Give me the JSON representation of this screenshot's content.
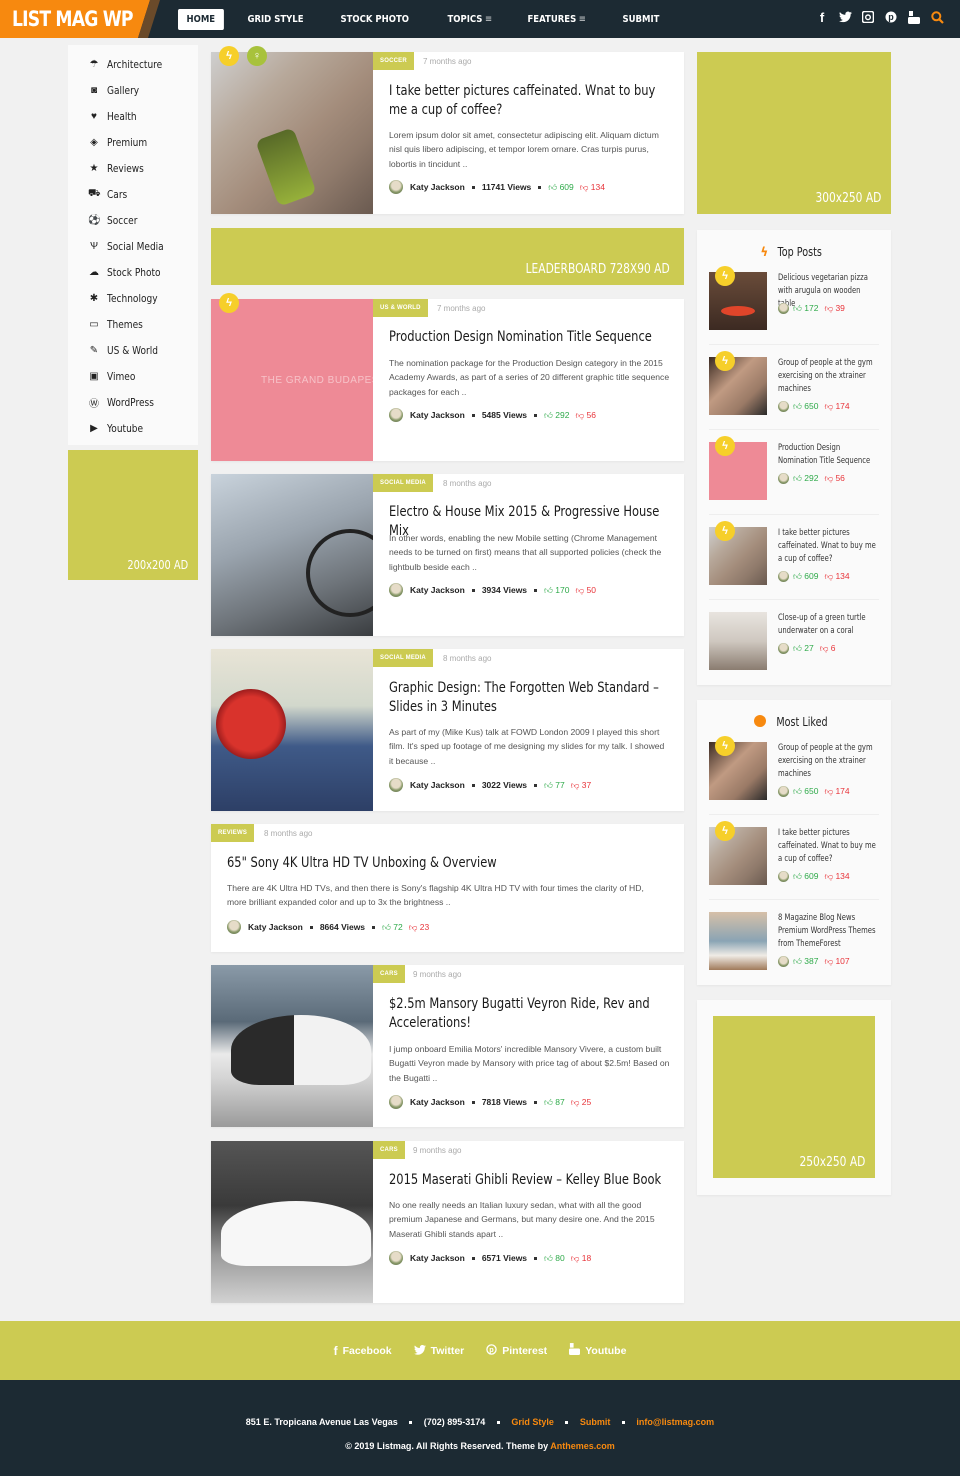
{
  "header": {
    "logo": "LIST MAG WP",
    "nav": [
      {
        "label": "HOME",
        "active": true
      },
      {
        "label": "GRID STYLE"
      },
      {
        "label": "STOCK PHOTO"
      },
      {
        "label": "TOPICS",
        "menu": "≡"
      },
      {
        "label": "FEATURES",
        "menu": "≡"
      },
      {
        "label": "SUBMIT"
      }
    ],
    "social_icons": [
      "facebook-icon",
      "twitter-icon",
      "instagram-icon",
      "pinterest-icon",
      "youtube-icon",
      "search-icon"
    ],
    "accent_color": "#f7890f",
    "bg_color": "#1c2a33"
  },
  "left_sidebar": {
    "categories": [
      {
        "label": "Architecture",
        "icon": "umbrella-icon"
      },
      {
        "label": "Gallery",
        "icon": "camera-icon"
      },
      {
        "label": "Health",
        "icon": "heartbeat-icon"
      },
      {
        "label": "Premium",
        "icon": "cube-icon"
      },
      {
        "label": "Reviews",
        "icon": "star-icon"
      },
      {
        "label": "Cars",
        "icon": "car-icon"
      },
      {
        "label": "Soccer",
        "icon": "soccer-ball-icon"
      },
      {
        "label": "Social Media",
        "icon": "rebel-icon"
      },
      {
        "label": "Stock Photo",
        "icon": "cloud-upload-icon"
      },
      {
        "label": "Technology",
        "icon": "bug-icon"
      },
      {
        "label": "Themes",
        "icon": "laptop-icon"
      },
      {
        "label": "US & World",
        "icon": "pen-icon"
      },
      {
        "label": "Vimeo",
        "icon": "vimeo-icon"
      },
      {
        "label": "WordPress",
        "icon": "wordpress-icon"
      },
      {
        "label": "Youtube",
        "icon": "youtube-play-icon"
      }
    ],
    "ad_label": "200x200 AD"
  },
  "leaderboard_ad": "LEADERBOARD 728X90 AD",
  "posts": [
    {
      "category": "SOCCER",
      "time": "7 months ago",
      "title": "I take better pictures caffeinated. Wnat to buy me a cup of coffee?",
      "excerpt": "Lorem ipsum dolor sit amet, consectetur adipiscing elit. Aliquam dictum nisl quis libero adipiscing, et tempor lorem ornare. Cras turpis purus, lobortis in tincidunt ..",
      "author": "Katy Jackson",
      "views": "11741 Views",
      "likes": "609",
      "dislikes": "134"
    },
    {
      "category": "US & WORLD",
      "time": "7 months ago",
      "title": "Production Design Nomination Title Sequence",
      "excerpt": "The nomination package for the Production Design category in the 2015 Academy Awards, as part of a series of 20 different graphic title sequence packages for each ..",
      "author": "Katy Jackson",
      "views": "5485 Views",
      "likes": "292",
      "dislikes": "56"
    },
    {
      "category": "SOCIAL MEDIA",
      "time": "8 months ago",
      "title": "Electro & House Mix 2015 & Progressive House Mix",
      "excerpt": "In other words, enabling the new Mobile setting (Chrome Management needs to be turned on first) means that all supported policies (check the lightbulb beside each ..",
      "author": "Katy Jackson",
      "views": "3934 Views",
      "likes": "170",
      "dislikes": "50"
    },
    {
      "category": "SOCIAL MEDIA",
      "time": "8 months ago",
      "title": "Graphic Design: The Forgotten Web Standard – Slides in 3 Minutes",
      "excerpt": "As part of my (Mike Kus) talk at FOWD London 2009 I played this short film. It's sped up footage of me designing my slides for my talk. I showed it because ..",
      "author": "Katy Jackson",
      "views": "3022 Views",
      "likes": "77",
      "dislikes": "37"
    },
    {
      "category": "REVIEWS",
      "time": "8 months ago",
      "title": "65\" Sony 4K Ultra HD TV Unboxing & Overview",
      "excerpt": "There are 4K Ultra HD TVs, and then there is Sony's flagship 4K Ultra HD TV with four times the clarity of HD, more brilliant expanded color and up to 3x the brightness ..",
      "author": "Katy Jackson",
      "views": "8664 Views",
      "likes": "72",
      "dislikes": "23"
    },
    {
      "category": "CARS",
      "time": "9 months ago",
      "title": "$2.5m Mansory Bugatti Veyron Ride, Rev and Accelerations!",
      "excerpt": "I jump onboard Emilia Motors' incredible Mansory Vivere, a custom built Bugatti Veyron made by Mansory with price tag of about $2.5m! Based on the Bugatti ..",
      "author": "Katy Jackson",
      "views": "7818 Views",
      "likes": "87",
      "dislikes": "25"
    },
    {
      "category": "CARS",
      "time": "9 months ago",
      "title": "2015 Maserati Ghibli Review – Kelley Blue Book",
      "excerpt": "No one really needs an Italian luxury sedan, what with all the good premium Japanese and Germans, but many desire one. And the 2015 Maserati Ghibli stands apart ..",
      "author": "Katy Jackson",
      "views": "6571 Views",
      "likes": "80",
      "dislikes": "18"
    }
  ],
  "right_sidebar": {
    "ad_top": "300x250 AD",
    "top_posts": {
      "title": "Top Posts",
      "items": [
        {
          "title": "Delicious vegetarian pizza with arugula on wooden table",
          "likes": "172",
          "dislikes": "39"
        },
        {
          "title": "Group of people at the gym exercising on the xtrainer machines",
          "likes": "650",
          "dislikes": "174"
        },
        {
          "title": "Production Design Nomination Title Sequence",
          "likes": "292",
          "dislikes": "56"
        },
        {
          "title": "I take better pictures caffeinated. Wnat to buy me a cup of coffee?",
          "likes": "609",
          "dislikes": "134"
        },
        {
          "title": "Close-up of a green turtle underwater on a coral",
          "likes": "27",
          "dislikes": "6"
        }
      ]
    },
    "most_liked": {
      "title": "Most Liked",
      "items": [
        {
          "title": "Group of people at the gym exercising on the xtrainer machines",
          "likes": "650",
          "dislikes": "174"
        },
        {
          "title": "I take better pictures caffeinated. Wnat to buy me a cup of coffee?",
          "likes": "609",
          "dislikes": "134"
        },
        {
          "title": "8 Magazine Blog News Premium WordPress Themes from ThemeForest",
          "likes": "387",
          "dislikes": "107"
        }
      ]
    },
    "ad_bottom": "250x250 AD",
    "ad_color": "#cccb52"
  },
  "footer": {
    "social": [
      {
        "label": "Facebook",
        "icon": "facebook-icon"
      },
      {
        "label": "Twitter",
        "icon": "twitter-icon"
      },
      {
        "label": "Pinterest",
        "icon": "pinterest-icon"
      },
      {
        "label": "Youtube",
        "icon": "youtube-icon"
      }
    ],
    "address": "851 E. Tropicana Avenue Las Vegas",
    "phone": "(702) 895-3174",
    "link_grid": "Grid Style",
    "link_submit": "Submit",
    "email": "info@listmag.com",
    "copyright": "© 2019 Listmag. All Rights Reserved. Theme by",
    "theme_link": "Anthemes.com"
  }
}
